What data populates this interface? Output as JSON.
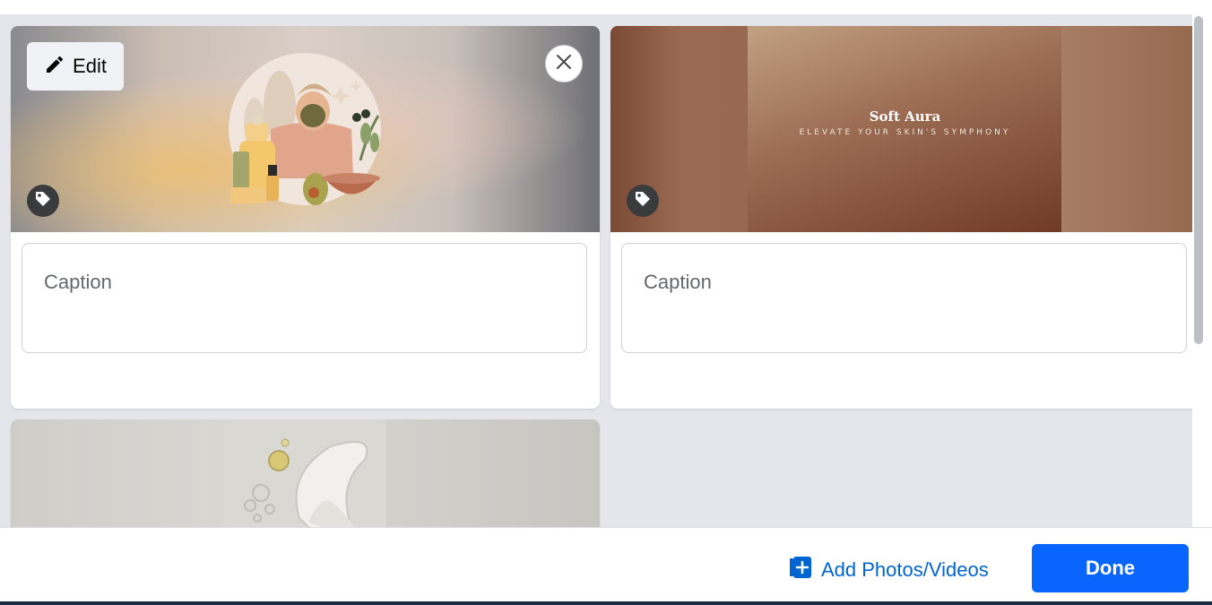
{
  "editor": {
    "cards": [
      {
        "edit_label": "Edit",
        "caption_placeholder": "Caption",
        "media_description": "skincare-illustration"
      },
      {
        "caption_placeholder": "Caption",
        "brand_title": "Soft Aura",
        "brand_tagline": "ELEVATE YOUR SKIN'S SYMPHONY",
        "media_description": "brand-banner"
      },
      {
        "media_description": "cream-serum-photo"
      }
    ]
  },
  "footer": {
    "add_media_label": "Add Photos/Videos",
    "done_label": "Done"
  },
  "colors": {
    "primary": "#0866ff",
    "link": "#0064d1",
    "background": "#e4e6eb"
  },
  "icons": [
    "pencil-icon",
    "close-icon",
    "tag-icon",
    "add-photo-icon"
  ]
}
